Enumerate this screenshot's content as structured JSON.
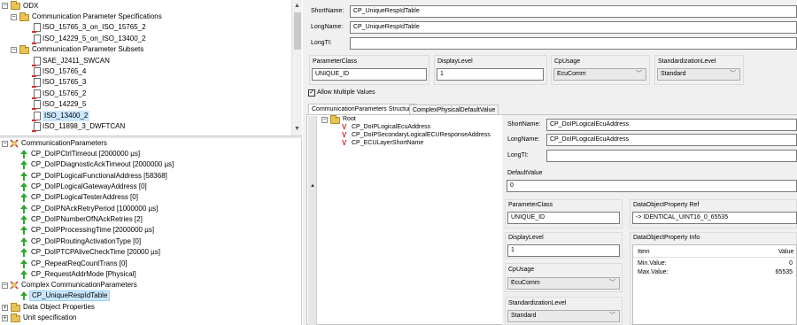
{
  "top_tree": {
    "root": {
      "label": "ODX",
      "expander": "−"
    },
    "items": [
      {
        "label": "Communication Parameter Specifications",
        "type": "folder",
        "expander": "−"
      },
      {
        "label": "ISO_15765_3_on_ISO_15765_2",
        "type": "doc"
      },
      {
        "label": "ISO_14229_5_on_ISO_13400_2",
        "type": "doc"
      },
      {
        "label": "Communication Parameter Subsets",
        "type": "folder",
        "expander": "−"
      },
      {
        "label": "SAE_J2411_SWCAN",
        "type": "doc"
      },
      {
        "label": "ISO_15765_4",
        "type": "doc"
      },
      {
        "label": "ISO_15765_3",
        "type": "doc"
      },
      {
        "label": "ISO_15765_2",
        "type": "doc"
      },
      {
        "label": "ISO_14229_5",
        "type": "doc"
      },
      {
        "label": "ISO_13400_2",
        "type": "doc",
        "selected": true
      },
      {
        "label": "ISO_11898_3_DWFTCAN",
        "type": "doc"
      }
    ]
  },
  "bottom_tree": {
    "comm_params": {
      "label": "CommunicationParameters",
      "expander": "−"
    },
    "params": [
      "CP_DoIPCtrlTimeout [2000000 µs]",
      "CP_DoIPDiagnosticAckTimeout [2000000 µs]",
      "CP_DoIPLogicalFunctionalAddress [58368]",
      "CP_DoIPLogicalGatewayAddress [0]",
      "CP_DoIPLogicalTesterAddress [0]",
      "CP_DoIPNAckRetryPeriod [1000000 µs]",
      "CP_DoIPNumberOfNAckRetries [2]",
      "CP_DoIPProcessingTime [2000000 µs]",
      "CP_DoIPRoutingActivationType [0]",
      "CP_DoIPTCPAliveCheckTime [20000 µs]",
      "CP_RepeatReqCountTrans [0]",
      "CP_RequestAddrMode [Physical]"
    ],
    "complex": {
      "label": "Complex CommunicationParameters",
      "expander": "−"
    },
    "complex_item": "CP_UniqueRespIdTable",
    "data_object": {
      "label": "Data Object Properties",
      "expander": "+"
    },
    "unit_spec": {
      "label": "Unit specification",
      "expander": "+"
    }
  },
  "detail": {
    "shortname_label": "ShortName:",
    "shortname_value": "CP_UniqueRespIdTable",
    "longname_label": "LongName:",
    "longname_value": "CP_UniqueRespIdTable",
    "longti_label": "LongTI:",
    "longti_value": "",
    "paramclass_label": "ParameterClass",
    "paramclass_value": "UNIQUE_ID",
    "displaylevel_label": "DisplayLevel",
    "displaylevel_value": "1",
    "cpusage_label": "CpUsage",
    "cpusage_value": "EcuComm",
    "stdlevel_label": "StandardizationLevel",
    "stdlevel_value": "Standard",
    "allow_multiple_label": "Allow Multiple Values",
    "allow_multiple_checked": true,
    "tabs": [
      "CommunicationParameters Structure",
      "ComplexPhysicalDefaultValue"
    ],
    "active_tab": 0
  },
  "structure_tree": {
    "root": "Root",
    "items": [
      "CP_DoIPLogicalEcuAddress",
      "CP_DoIPSecondaryLogicalECUResponseAddress",
      "CP_ECULayerShortName"
    ]
  },
  "sub_detail": {
    "shortname_label": "ShortName:",
    "shortname_value": "CP_DoIPLogicalEcuAddress",
    "longname_label": "LongName:",
    "longname_value": "CP_DoIPLogicalEcuAddress",
    "longti_label": "LongTI:",
    "longti_value": "",
    "default_label": "DefaultValue",
    "default_value": "0",
    "paramclass_label": "ParameterClass",
    "paramclass_value": "UNIQUE_ID",
    "dop_ref_label": "DataObjectProperty Ref",
    "dop_ref_value": "->  IDENTICAL_UINT16_0_65535",
    "displaylevel_label": "DisplayLevel",
    "displaylevel_value": "1",
    "dop_info_label": "DataObjectProperty Info",
    "dop_info_headers": [
      "Item",
      "Value"
    ],
    "dop_info_rows": [
      {
        "item": "Min.Value:",
        "value": "0"
      },
      {
        "item": "Max.Value:",
        "value": "65535"
      }
    ],
    "cpusage_label": "CpUsage",
    "cpusage_value": "EcuComm",
    "stdlevel_label": "StandardizationLevel",
    "stdlevel_value": "Standard"
  },
  "colors": {
    "selection": "#cce8ff",
    "panel_bg": "#f0f0f0",
    "param_arrow": "#2fa52f",
    "vee_red": "#c8252b"
  },
  "icons": {
    "expander": "expander-icon",
    "folder": "folder-icon",
    "document": "document-icon",
    "parameter": "green-arrow-icon",
    "struct_param": "red-v-icon",
    "scroll_left": "left-arrow-icon",
    "combo": "chevron-down-icon"
  }
}
